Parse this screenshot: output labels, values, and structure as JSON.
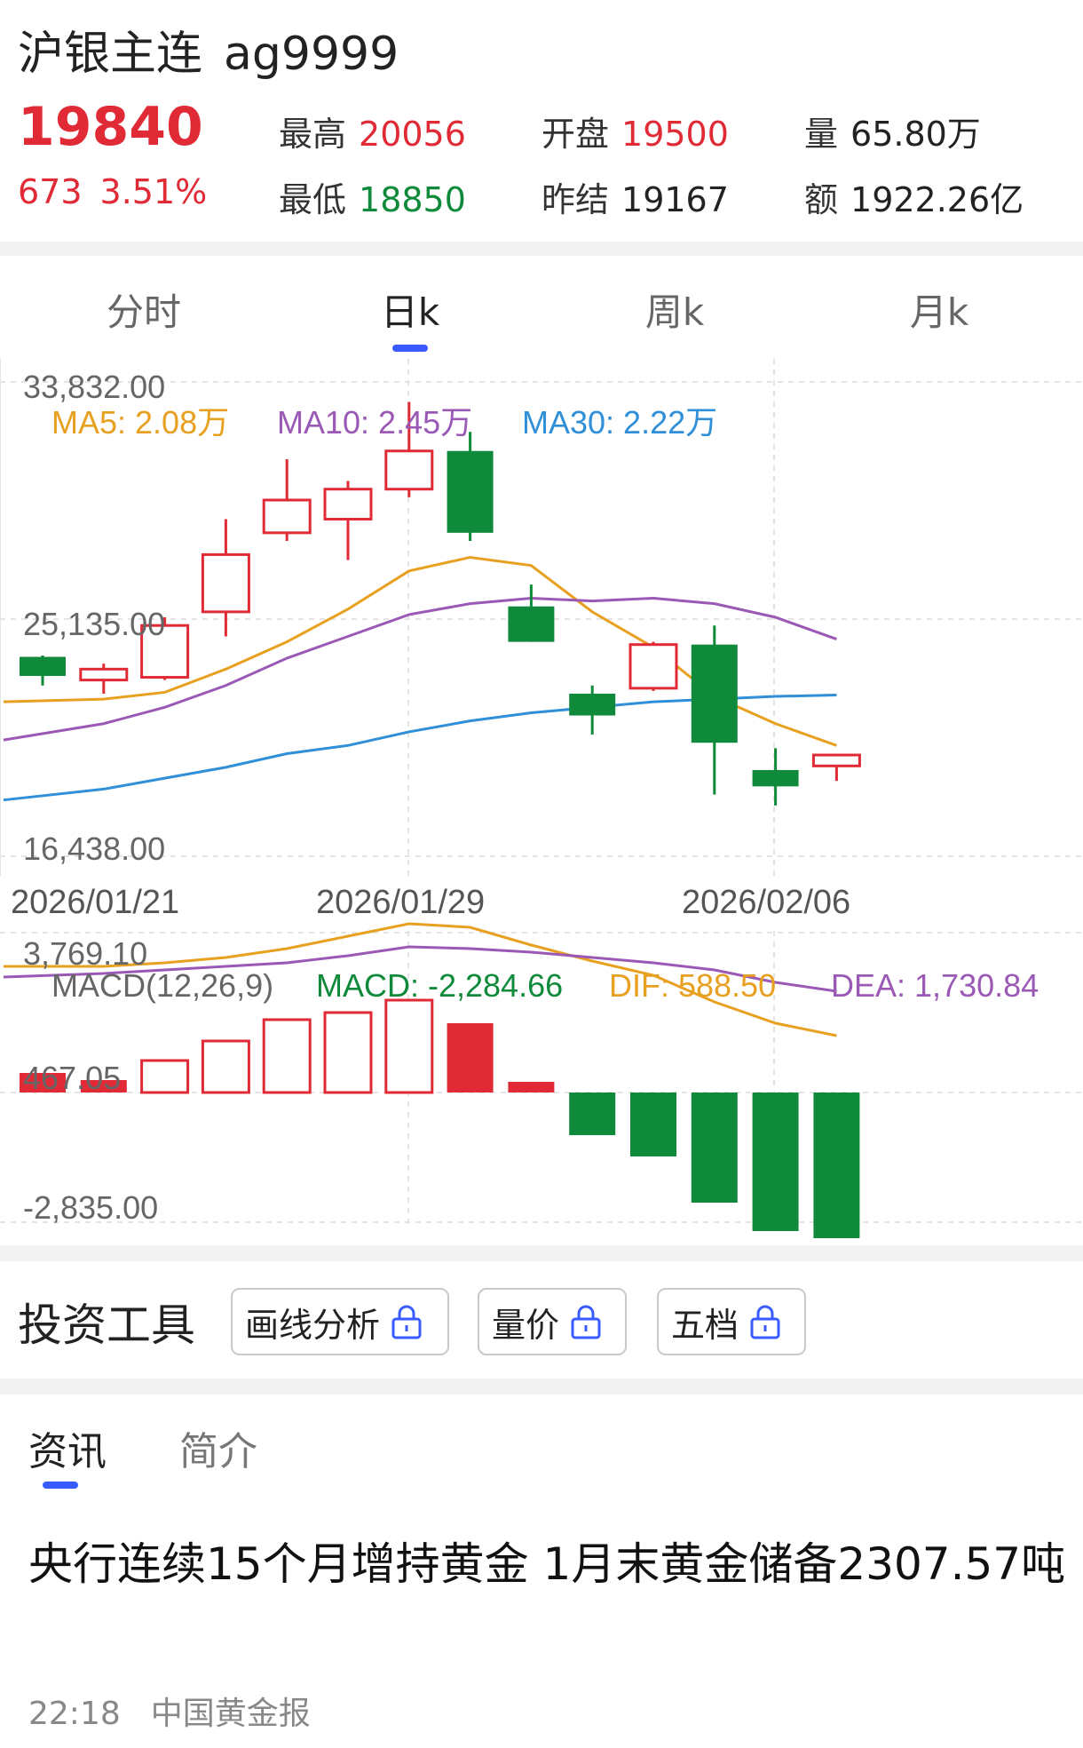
{
  "header": {
    "name": "沪银主连",
    "code": "ag9999",
    "price": "19840",
    "change": "673",
    "change_pct": "3.51%",
    "high_label": "最高",
    "high": "20056",
    "low_label": "最低",
    "low": "18850",
    "open_label": "开盘",
    "open": "19500",
    "prev_settle_label": "昨结",
    "prev_settle": "19167",
    "volume_label": "量",
    "volume": "65.80万",
    "amount_label": "额",
    "amount": "1922.26亿"
  },
  "tabs": [
    "分时",
    "日k",
    "周k",
    "月k"
  ],
  "active_tab": "日k",
  "chart_data": [
    {
      "type": "candlestick",
      "ylim": [
        16438.0,
        33832.0
      ],
      "y_ticks": [
        "33,832.00",
        "25,135.00",
        "16,438.00"
      ],
      "x_labels": [
        "2026/01/21",
        "2026/01/29",
        "2026/02/06"
      ],
      "legend": [
        {
          "name": "MA5",
          "value": "2.08万",
          "color": "#e8a020"
        },
        {
          "name": "MA10",
          "value": "2.45万",
          "color": "#9b59b6"
        },
        {
          "name": "MA30",
          "value": "2.22万",
          "color": "#2f8fd8"
        }
      ],
      "candles": [
        {
          "o": 23750,
          "c": 23050,
          "h": 23800,
          "l": 22700
        },
        {
          "o": 22900,
          "c": 23300,
          "h": 23500,
          "l": 22400
        },
        {
          "o": 23000,
          "c": 24900,
          "h": 25200,
          "l": 22900
        },
        {
          "o": 25400,
          "c": 27500,
          "h": 28800,
          "l": 24500
        },
        {
          "o": 28300,
          "c": 29500,
          "h": 31000,
          "l": 28000
        },
        {
          "o": 28800,
          "c": 29900,
          "h": 30200,
          "l": 27300
        },
        {
          "o": 29900,
          "c": 31300,
          "h": 33100,
          "l": 29600
        },
        {
          "o": 31300,
          "c": 28300,
          "h": 32000,
          "l": 28000
        },
        {
          "o": 25600,
          "c": 24300,
          "h": 26400,
          "l": 24300
        },
        {
          "o": 22400,
          "c": 21600,
          "h": 22700,
          "l": 20900
        },
        {
          "o": 22600,
          "c": 24200,
          "h": 24300,
          "l": 22500
        },
        {
          "o": 24200,
          "c": 20600,
          "h": 24900,
          "l": 18700
        },
        {
          "o": 19600,
          "c": 19000,
          "h": 20400,
          "l": 18300
        },
        {
          "o": 19750,
          "c": 20150,
          "h": 20150,
          "l": 19200
        }
      ],
      "ma5": [
        22100,
        22200,
        22450,
        23300,
        24300,
        25500,
        26900,
        27400,
        27100,
        25400,
        24100,
        22300,
        21300,
        20500
      ],
      "ma10": [
        20700,
        21300,
        21900,
        22700,
        23700,
        24500,
        25300,
        25700,
        25900,
        25800,
        25900,
        25700,
        25200,
        24400
      ],
      "ma30": [
        18500,
        18900,
        19300,
        19700,
        20200,
        20500,
        21000,
        21400,
        21700,
        21900,
        22100,
        22200,
        22300,
        22350
      ]
    },
    {
      "type": "bar",
      "title": "MACD(12,26,9)",
      "ylim": [
        -2835.0,
        3769.1
      ],
      "y_ticks": [
        "3,769.10",
        "467.05",
        "-2,835.00"
      ],
      "legend": [
        {
          "name": "MACD",
          "value": "-2,284.66",
          "color": "#0f8a3a"
        },
        {
          "name": "DIF",
          "value": "588.50",
          "color": "#e8a020"
        },
        {
          "name": "DEA",
          "value": "1,730.84",
          "color": "#9b59b6"
        }
      ],
      "macd": [
        550,
        350,
        900,
        1450,
        2050,
        2250,
        2600,
        1950,
        300,
        -1200,
        -1800,
        -3100,
        -3900,
        -4100
      ],
      "dif": [
        2950,
        2950,
        3050,
        3200,
        3450,
        3800,
        4150,
        4050,
        3550,
        3100,
        2700,
        1950,
        1350,
        1000
      ],
      "dea": [
        2650,
        2750,
        2850,
        2950,
        3050,
        3250,
        3500,
        3450,
        3350,
        3200,
        3050,
        2850,
        2500,
        2250
      ]
    }
  ],
  "tools": {
    "title": "投资工具",
    "buttons": [
      "画线分析",
      "量价",
      "五档"
    ]
  },
  "news_tabs": [
    "资讯",
    "简介"
  ],
  "news": {
    "headline": "央行连续15个月增持黄金 1月末黄金储备2307.57吨",
    "time": "22:18",
    "source": "中国黄金报"
  },
  "colors": {
    "up": "#e02a36",
    "down": "#0f8a3a",
    "accent": "#3a5bff"
  }
}
